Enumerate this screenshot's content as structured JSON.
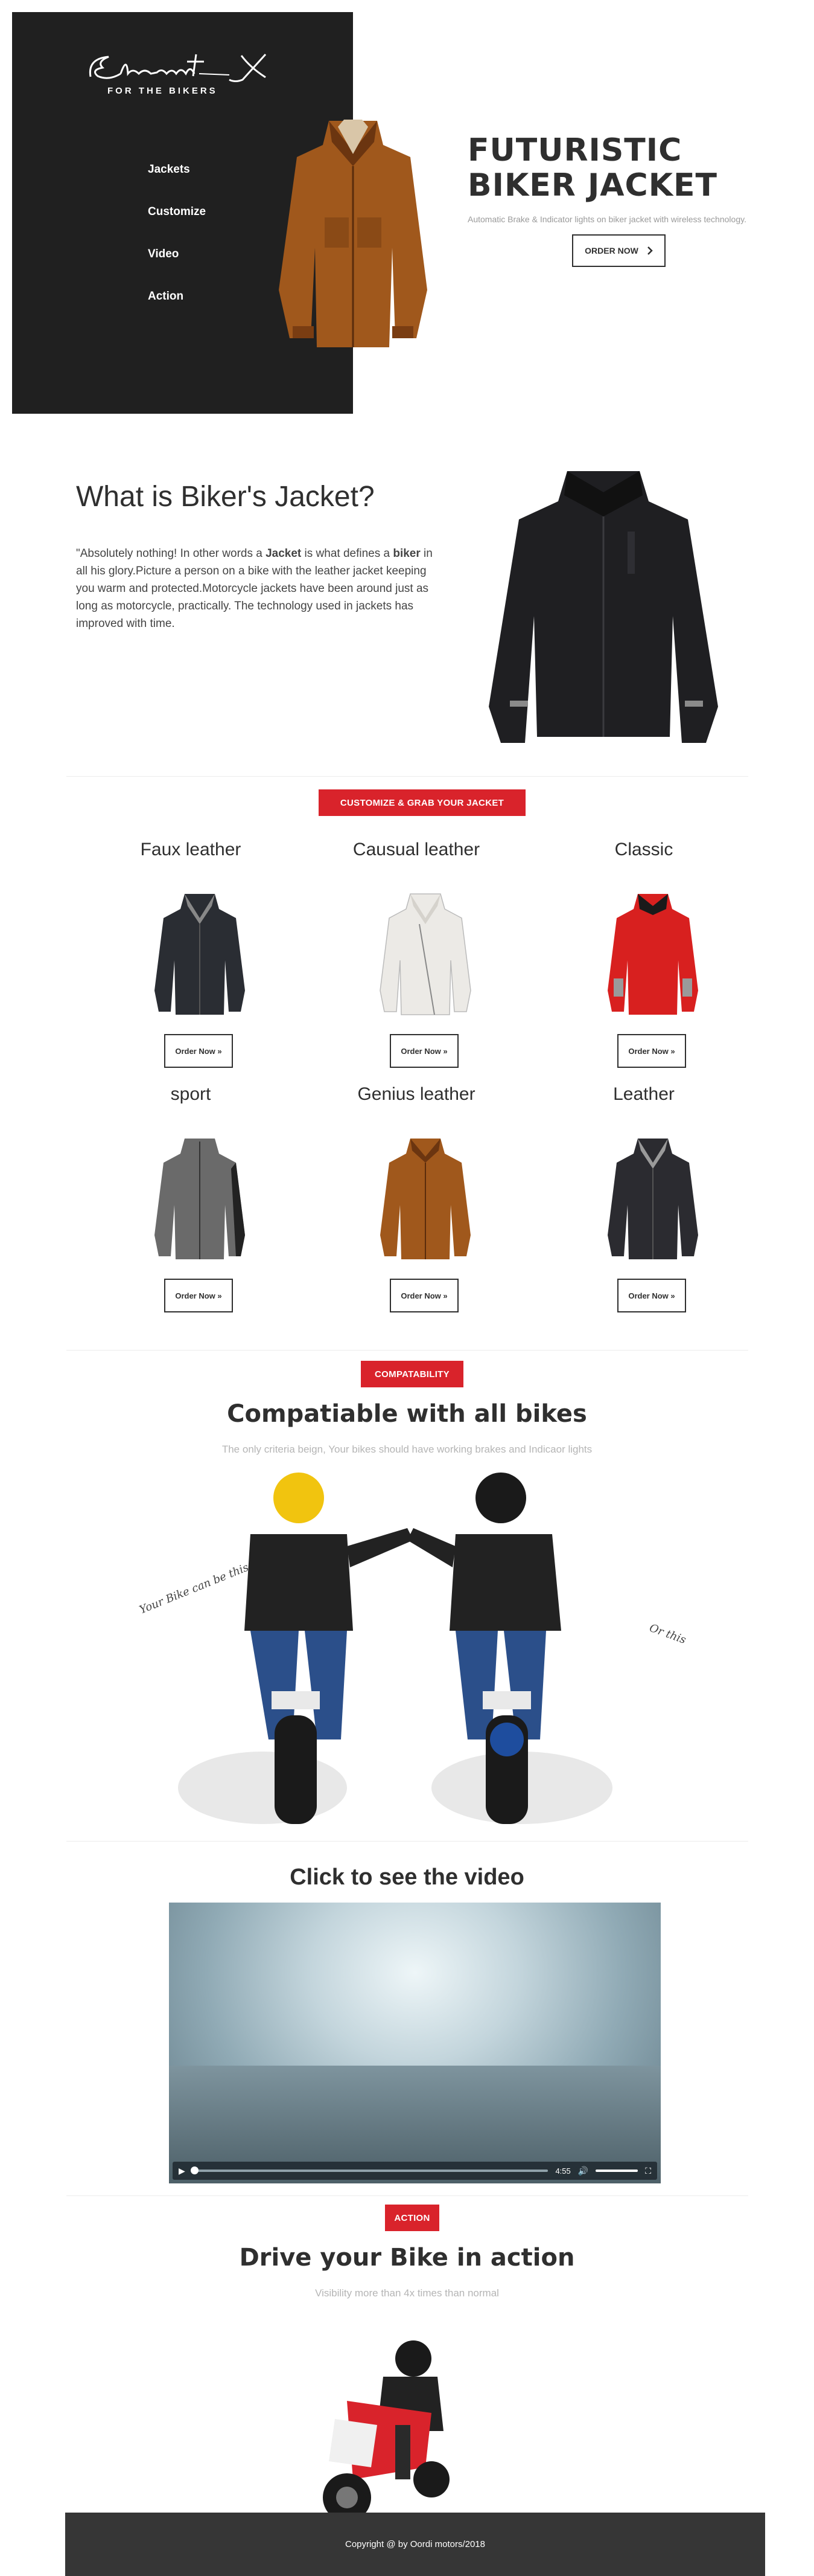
{
  "brand": {
    "script": "Element X",
    "tagline": "FOR THE BIKERS"
  },
  "nav": [
    {
      "label": "Jackets"
    },
    {
      "label": "Customize"
    },
    {
      "label": "Video"
    },
    {
      "label": "Action"
    }
  ],
  "hero": {
    "title_line1": "FUTURISTIC",
    "title_line2": "BIKER JACKET",
    "subtitle": "Automatic Brake & Indicator lights on biker jacket with wireless technology.",
    "order_label": "ORDER NOW",
    "order_icon": "chevron-right-icon"
  },
  "about": {
    "title": "What is Biker's Jacket?",
    "p1": "\"Absolutely nothing! In other words a ",
    "b1": "Jacket",
    "p2": " is what defines a ",
    "b2": "biker",
    "p3": " in all his glory.Picture a person on a bike with the leather jacket keeping you warm and protected.Motorcycle jackets have been around just as long as motorcycle, practically. The technology used in jackets has improved with time."
  },
  "customize": {
    "badge": "CUSTOMIZE & GRAB YOUR JACKET",
    "products": [
      {
        "name": "Faux leather",
        "button": "Order Now »",
        "color": "#2a2d33"
      },
      {
        "name": "Causual leather",
        "button": "Order Now »",
        "color": "#eceae6"
      },
      {
        "name": "Classic",
        "button": "Order Now »",
        "color": "#d8201f"
      },
      {
        "name": "sport",
        "button": "Order Now »",
        "color": "#6a6a6a"
      },
      {
        "name": "Genius leather",
        "button": "Order Now »",
        "color": "#a0581c"
      },
      {
        "name": "Leather",
        "button": "Order Now »",
        "color": "#2b2b30"
      }
    ]
  },
  "compat": {
    "badge": "COMPATABILITY",
    "title": "Compatiable with all bikes",
    "subtitle": "The only criteria beign, Your bikes should have working brakes and Indicaor lights",
    "note_left": "Your Bike can be this",
    "note_right": "Or this"
  },
  "video": {
    "title": "Click to see the video",
    "time": "4:55"
  },
  "action": {
    "badge": "ACTION",
    "title": "Drive your Bike in action",
    "subtitle": "Visibility more than 4x times than normal"
  },
  "footer": {
    "text": "Copyright @ by Oordi motors/2018"
  },
  "colors": {
    "accent": "#d9232b",
    "dark": "#202020",
    "footer": "#363636"
  }
}
